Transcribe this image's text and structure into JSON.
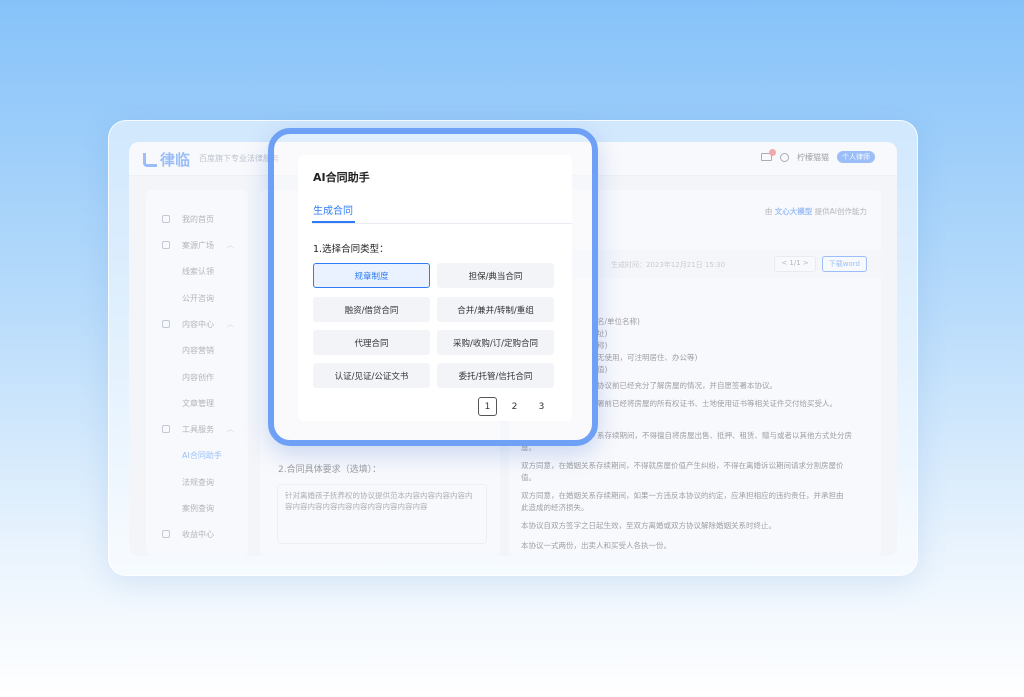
{
  "app": {
    "brand": "律临",
    "slogan": "百度旗下专业法律服务",
    "user_name": "柠檬猫猫",
    "user_badge": "个人律师",
    "mail_count": "1"
  },
  "sidebar": {
    "items": [
      {
        "label": "我的首页"
      },
      {
        "label": "案源广场"
      },
      {
        "label": "线索认领"
      },
      {
        "label": "公开咨询"
      },
      {
        "label": "内容中心"
      },
      {
        "label": "内容营销"
      },
      {
        "label": "内容创作"
      },
      {
        "label": "文章管理"
      },
      {
        "label": "工具服务"
      },
      {
        "label": "AI合同助手"
      },
      {
        "label": "法规查询"
      },
      {
        "label": "案例查询"
      },
      {
        "label": "收益中心"
      }
    ]
  },
  "left_panel": {
    "requirement_title": "2.合同具体要求（选填）：",
    "requirement_text": "针对离婚孩子抚养权的协议提供范本内容内容内容内容内容内容内容内容内容内容内容内容内容内容"
  },
  "right_panel": {
    "powered_prefix": "由",
    "powered_brand": "文心大模型",
    "powered_suffix": "提供AI创作能力",
    "doc_date": "生成时间：2023年12月21日 15:30",
    "pager": "< 1/1 >",
    "download_label": "下载word",
    "lines": [
      "名/单位名称)",
      "址)",
      "称)",
      "无使用，可注明居住、办公等)",
      "值)",
      "协议前已经充分了解房屋的情况，并自愿签署本协议。",
      "署前已经将房屋的所有权证书、土地使用证书等相关证件交付给买受人。",
      "系存续期间，不得擅自将房屋出售、抵押、租赁、赠与或者以其他方式处分房",
      "屋。",
      "双方同意，在婚姻关系存续期间，不得就房屋价值产生纠纷，不得在离婚诉讼期间请求分割房屋价",
      "值。",
      "双方同意，在婚姻关系存续期间，如果一方违反本协议的约定，应承担相应的违约责任，并承担由",
      "此造成的经济损失。",
      "本协议自双方签字之日起生效，至双方离婚或双方协议解除婚姻关系时终止。",
      "本协议一式两份，出卖人和买受人各执一份。"
    ]
  },
  "modal": {
    "title": "AI合同助手",
    "tab": "生成合同",
    "section_label": "1.选择合同类型：",
    "options": [
      {
        "label": "规章制度",
        "selected": true
      },
      {
        "label": "担保/典当合同"
      },
      {
        "label": "融资/借贷合同"
      },
      {
        "label": "合并/兼并/转制/重组"
      },
      {
        "label": "代理合同"
      },
      {
        "label": "采购/收购/订/定购合同"
      },
      {
        "label": "认证/见证/公证文书"
      },
      {
        "label": "委托/托管/信托合同"
      }
    ],
    "pages": [
      "1",
      "2",
      "3"
    ]
  },
  "colors": {
    "accent": "#2f7cf6",
    "modal_border": "#6ea0f5",
    "badge_red": "#f24d4d"
  }
}
